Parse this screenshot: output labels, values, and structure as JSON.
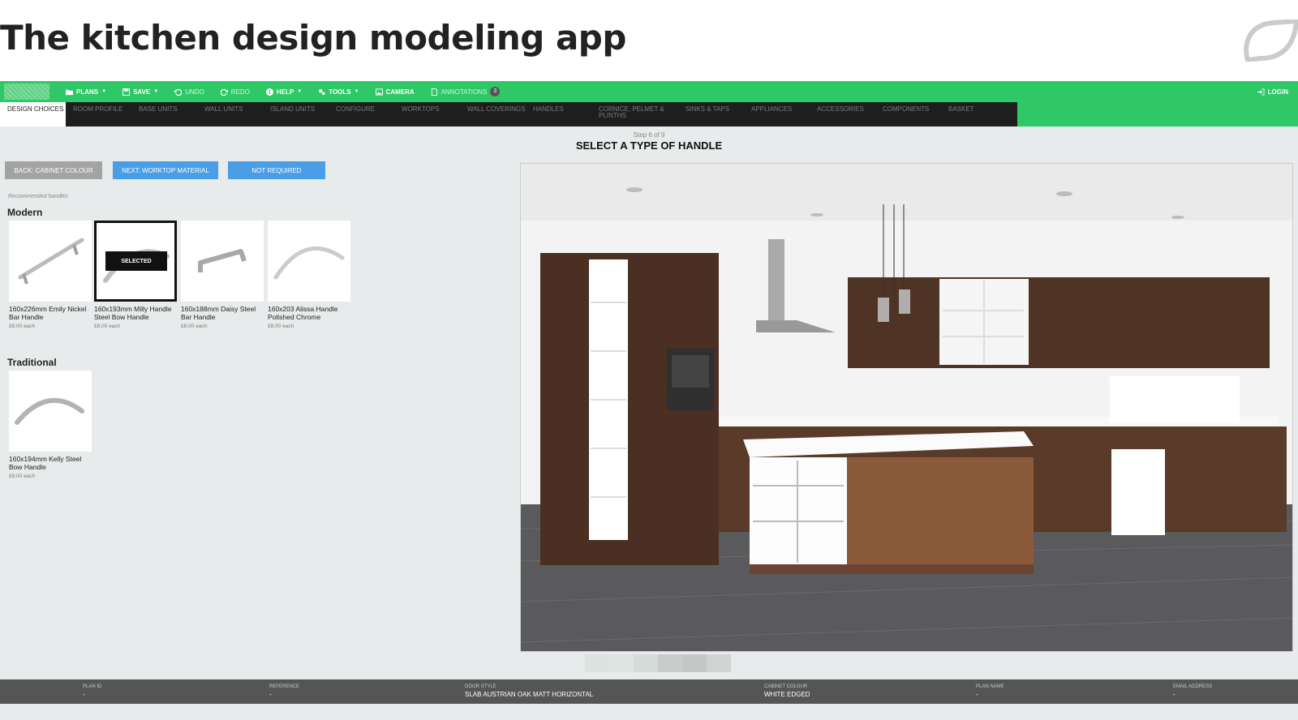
{
  "slide": {
    "title": "The kitchen design modeling app"
  },
  "toolbar": {
    "items": [
      {
        "label": "PLANS",
        "icon": "folder-icon",
        "caret": true
      },
      {
        "label": "SAVE",
        "icon": "save-icon",
        "caret": true
      },
      {
        "label": "UNDO",
        "icon": "undo-icon",
        "caret": false
      },
      {
        "label": "REDO",
        "icon": "redo-icon",
        "caret": false
      },
      {
        "label": "HELP",
        "icon": "info-icon",
        "caret": true
      },
      {
        "label": "TOOLS",
        "icon": "gears-icon",
        "caret": true
      },
      {
        "label": "CAMERA",
        "icon": "image-icon",
        "caret": false
      },
      {
        "label": "ANNOTATIONS",
        "icon": "document-icon",
        "caret": false,
        "badge": "3"
      }
    ],
    "login": "LOGIN"
  },
  "steps": [
    "DESIGN CHOICES",
    "ROOM PROFILE",
    "BASE UNITS",
    "WALL UNITS",
    "ISLAND UNITS",
    "CONFIGURE",
    "WORKTOPS",
    "WALL COVERINGS",
    "HANDLES",
    "CORNICE, PELMET & PLINTHS",
    "SINKS & TAPS",
    "APPLIANCES",
    "ACCESSORIES",
    "COMPONENTS",
    "BASKET"
  ],
  "step_info": {
    "count": "Step 6 of 9",
    "title": "SELECT A TYPE OF HANDLE"
  },
  "buttons": {
    "back": "BACK: CABINET COLOUR",
    "next": "NEXT: WORKTOP MATERIAL",
    "not_required": "NOT REQUIRED"
  },
  "recommended_label": "Recommended handles",
  "groups": {
    "modern": {
      "title": "Modern",
      "items": [
        {
          "name": "160x226mm Emily Nickel Bar Handle",
          "price": "£8.00 each"
        },
        {
          "name": "160x193mm Milly Handle Steel Bow Handle",
          "price": "£8.00 each",
          "selected_label": "SELECTED"
        },
        {
          "name": "160x188mm Daisy Steel Bar Handle",
          "price": "£8.00 each"
        },
        {
          "name": "160x203 Alissa Handle Polished Chrome",
          "price": "£8.00 each"
        }
      ]
    },
    "traditional": {
      "title": "Traditional",
      "items": [
        {
          "name": "160x194mm Kelly Steel Bow Handle",
          "price": "£8.00 each"
        }
      ]
    }
  },
  "footer": {
    "plan_id": {
      "label": "PLAN ID",
      "value": "-"
    },
    "reference": {
      "label": "REFERENCE",
      "value": "-"
    },
    "door_style": {
      "label": "DOOR STYLE",
      "value": "SLAB AUSTRIAN OAK MATT HORIZONTAL"
    },
    "cabinet_colour": {
      "label": "CABINET COLOUR",
      "value": "WHITE EDGED"
    },
    "plan_name": {
      "label": "PLAN NAME",
      "value": "-"
    },
    "email": {
      "label": "EMAIL ADDRESS",
      "value": "-"
    }
  },
  "colors": {
    "toolbar_green": "#2ec866",
    "nav_dark": "#1e1e1e",
    "button_blue": "#4a9ee6",
    "button_grey": "#a3a3a3",
    "footer_grey": "#555555"
  }
}
